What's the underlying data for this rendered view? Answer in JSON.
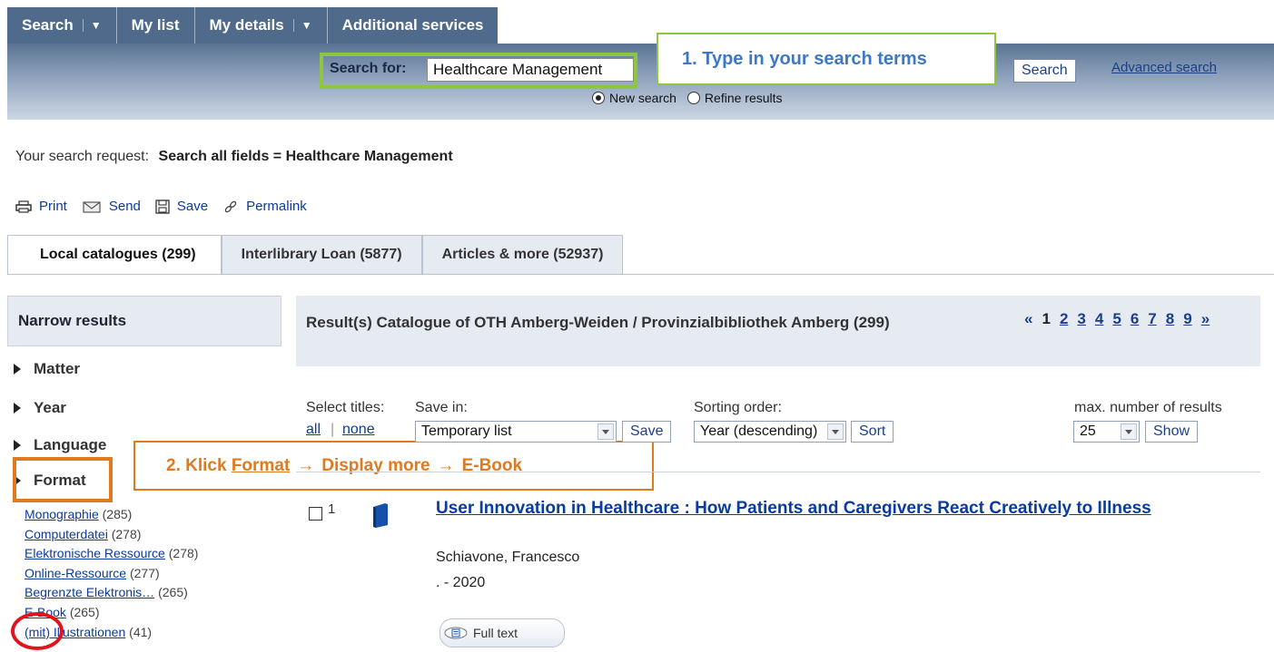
{
  "topnav": {
    "tabs": [
      "Search",
      "My list",
      "My details",
      "Additional services"
    ]
  },
  "search": {
    "label": "Search for:",
    "value": "Healthcare Management",
    "button": "Search",
    "advanced": "Advanced search",
    "options": [
      "New search",
      "Refine results"
    ],
    "selected_option": "New search"
  },
  "callouts": {
    "step1": "1. Type in your search terms",
    "step2_prefix": "2. Klick ",
    "step2_format": "Format",
    "step2_arrow": "→",
    "step2_more": "Display more",
    "step2_ebook": "E-Book",
    "accent_green": "#8fc63f",
    "accent_orange": "#e07a1f"
  },
  "request": {
    "label": "Your search request:",
    "value": "Search all fields = Healthcare Management"
  },
  "tools": {
    "print": "Print",
    "send": "Send",
    "save": "Save",
    "permalink": "Permalink"
  },
  "result_tabs": [
    "Local catalogues (299)",
    "Interlibrary Loan (5877)",
    "Articles & more (52937)"
  ],
  "narrow": {
    "title": "Narrow results",
    "facets": [
      "Matter",
      "Year",
      "Language",
      "Format"
    ],
    "format_values": [
      {
        "label": "Monographie",
        "count": "(285)"
      },
      {
        "label": "Computerdatei",
        "count": "(278)"
      },
      {
        "label": "Elektronische Ressource",
        "count": "(278)"
      },
      {
        "label": "Online-Ressource",
        "count": "(277)"
      },
      {
        "label": "Begrenzte Elektronis…",
        "count": "(265)"
      },
      {
        "label": "E-Book",
        "count": "(265)"
      },
      {
        "label": "(mit) Illustrationen",
        "count": "(41)"
      }
    ]
  },
  "results": {
    "heading": "Result(s) Catalogue of OTH Amberg-Weiden / Provinzialbibliothek Amberg (299)",
    "pager": {
      "first": "«",
      "current": "1",
      "pages": [
        "2",
        "3",
        "4",
        "5",
        "6",
        "7",
        "8",
        "9"
      ],
      "next": "»"
    },
    "controls": {
      "select_titles": "Select titles:",
      "all": "all",
      "none": "none",
      "save_in": "Save in:",
      "save_in_value": "Temporary list",
      "save_button": "Save",
      "sorting": "Sorting order:",
      "sorting_value": "Year (descending)",
      "sort_button": "Sort",
      "max_label": "max. number of results",
      "max_value": "25",
      "show_button": "Show"
    },
    "items": [
      {
        "number": "1",
        "title": "User Innovation in Healthcare : How Patients and Caregivers React Creatively to Illness",
        "author": "Schiavone, Francesco",
        "year": ". - 2020",
        "fulltext": "Full text"
      }
    ]
  }
}
